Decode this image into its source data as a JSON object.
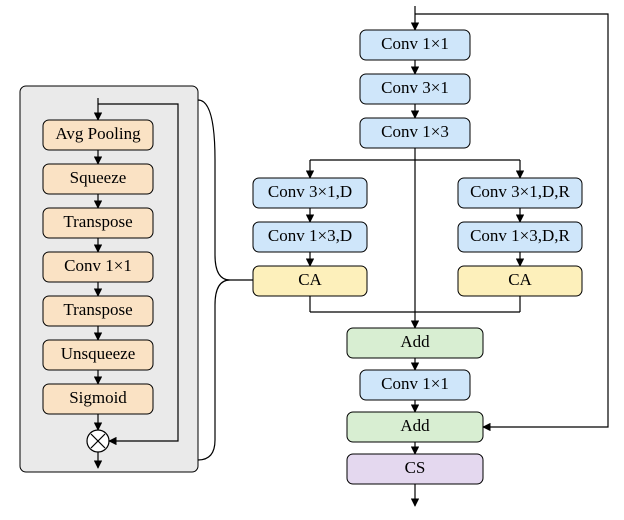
{
  "diagram": {
    "type": "neural-network-block-diagram",
    "layout": "two-panel: left=CA-detail, right=main-pipeline"
  },
  "left": {
    "blocks": [
      {
        "id": "avgpool",
        "label": "Avg Pooling"
      },
      {
        "id": "squeeze",
        "label": "Squeeze"
      },
      {
        "id": "transpose1",
        "label": "Transpose"
      },
      {
        "id": "conv1x1L",
        "label": "Conv 1×1"
      },
      {
        "id": "transpose2",
        "label": "Transpose"
      },
      {
        "id": "unsqueeze",
        "label": "Unsqueeze"
      },
      {
        "id": "sigmoid",
        "label": "Sigmoid"
      }
    ],
    "multiply_symbol": "⊗"
  },
  "right": {
    "top": [
      {
        "id": "conv1x1a",
        "label": "Conv 1×1"
      },
      {
        "id": "conv3x1",
        "label": "Conv 3×1"
      },
      {
        "id": "conv1x3",
        "label": "Conv 1×3"
      }
    ],
    "branchL": [
      {
        "id": "conv3x1D",
        "label": "Conv 3×1,D"
      },
      {
        "id": "conv1x3D",
        "label": "Conv 1×3,D"
      },
      {
        "id": "caL",
        "label": "CA"
      }
    ],
    "branchR": [
      {
        "id": "conv3x1DR",
        "label": "Conv 3×1,D,R"
      },
      {
        "id": "conv1x3DR",
        "label": "Conv 1×3,D,R"
      },
      {
        "id": "caR",
        "label": "CA"
      }
    ],
    "tail": [
      {
        "id": "add1",
        "label": "Add"
      },
      {
        "id": "conv1x1b",
        "label": "Conv 1×1"
      },
      {
        "id": "add2",
        "label": "Add"
      },
      {
        "id": "cs",
        "label": "CS"
      }
    ]
  },
  "legend_classes": {
    "Conv": "blue",
    "CA": "yellow",
    "Add": "green",
    "CS": "purple",
    "left_ops": "tan"
  }
}
